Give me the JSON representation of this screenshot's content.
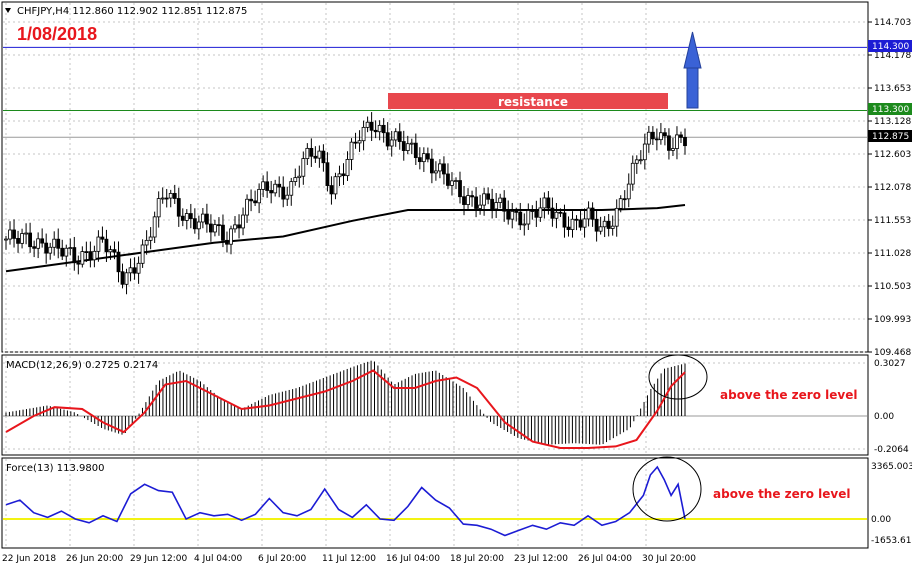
{
  "header": {
    "symbol_info": "CHFJPY,H4  112.860 112.902 112.851 112.875",
    "date_label": "1/08/2018"
  },
  "annotations": {
    "resistance": "resistance",
    "macd_note": "above the zero level",
    "force_note": "above the zero level"
  },
  "colors": {
    "grid": "#c4c4c4",
    "background": "#ffffff",
    "candles": "#000000",
    "fast_ma": "#ffffff",
    "slow_ma": "#000000",
    "macd_signal": "#e8161c",
    "force_line": "#1c1cd4",
    "zero_line": "#f3f312",
    "level_114300": "#1c1cd4",
    "level_113300": "#1c8a1c",
    "resistance_box": "#e8474d",
    "arrow": "#3a62d6"
  },
  "chart_data": [
    {
      "type": "candlestick",
      "panel": "price",
      "y_ticks": [
        "114.703",
        "114.178",
        "113.653",
        "113.128",
        "112.603",
        "112.078",
        "111.553",
        "111.028",
        "110.503",
        "109.993",
        "109.468"
      ],
      "ylim": [
        109.468,
        114.703
      ],
      "current_price_label": "112.875",
      "current_price": 112.875,
      "levels": [
        {
          "label": "114.300",
          "value": 114.3
        },
        {
          "label": "113.300",
          "value": 113.3
        }
      ],
      "x_ticks": [
        "22 Jun 2018",
        "26 Jun 20:00",
        "29 Jun 12:00",
        "4 Jul 04:00",
        "6 Jul 20:00",
        "11 Jul 12:00",
        "16 Jul 04:00",
        "18 Jul 20:00",
        "23 Jul 12:00",
        "26 Jul 04:00",
        "30 Jul 20:00"
      ],
      "close_path": [
        [
          0,
          111.26
        ],
        [
          6,
          111.2
        ],
        [
          10,
          110.92
        ],
        [
          14,
          111.25
        ],
        [
          17,
          110.58
        ],
        [
          20,
          111.15
        ],
        [
          23,
          112.0
        ],
        [
          26,
          111.62
        ],
        [
          29,
          111.46
        ],
        [
          32,
          111.3
        ],
        [
          34,
          111.65
        ],
        [
          36,
          111.9
        ],
        [
          38,
          112.12
        ],
        [
          41,
          112.02
        ],
        [
          43,
          112.48
        ],
        [
          45,
          112.68
        ],
        [
          47,
          112.08
        ],
        [
          49,
          112.4
        ],
        [
          51,
          112.9
        ],
        [
          53,
          113.15
        ],
        [
          55,
          112.85
        ],
        [
          57,
          112.75
        ],
        [
          60,
          112.62
        ],
        [
          63,
          112.25
        ],
        [
          66,
          111.95
        ],
        [
          69,
          111.85
        ],
        [
          72,
          111.72
        ],
        [
          75,
          111.6
        ],
        [
          78,
          111.75
        ],
        [
          80,
          111.62
        ],
        [
          82,
          111.5
        ],
        [
          84,
          111.58
        ],
        [
          86,
          111.4
        ],
        [
          88,
          111.68
        ],
        [
          90,
          112.18
        ],
        [
          92,
          112.68
        ],
        [
          93,
          112.88
        ],
        [
          94,
          113.0
        ],
        [
          96,
          112.75
        ],
        [
          98,
          112.8
        ]
      ],
      "series": [
        {
          "name": "",
          "style": "white moving average",
          "points": [
            [
              0,
              110.95
            ],
            [
              10,
              111.0
            ],
            [
              18,
              111.15
            ],
            [
              24,
              111.55
            ],
            [
              30,
              111.6
            ],
            [
              36,
              111.72
            ],
            [
              42,
              111.95
            ],
            [
              48,
              112.3
            ],
            [
              54,
              112.75
            ],
            [
              57,
              112.82
            ],
            [
              62,
              112.55
            ],
            [
              68,
              112.15
            ],
            [
              74,
              111.9
            ],
            [
              80,
              111.8
            ],
            [
              86,
              111.75
            ],
            [
              90,
              111.95
            ],
            [
              94,
              112.2
            ],
            [
              98,
              112.35
            ]
          ]
        },
        {
          "name": "",
          "style": "black moving average",
          "points": [
            [
              0,
              110.75
            ],
            [
              10,
              110.9
            ],
            [
              20,
              111.05
            ],
            [
              30,
              111.2
            ],
            [
              40,
              111.3
            ],
            [
              50,
              111.55
            ],
            [
              58,
              111.72
            ],
            [
              68,
              111.72
            ],
            [
              78,
              111.72
            ],
            [
              86,
              111.72
            ],
            [
              94,
              111.75
            ],
            [
              98,
              111.8
            ]
          ]
        }
      ]
    },
    {
      "type": "bar+line",
      "panel": "macd",
      "title": "MACD(12,26,9) 0.2725 0.2174",
      "y_ticks": [
        "0.3027",
        "0.00",
        "-0.2064"
      ],
      "ylim": [
        -0.25,
        0.34
      ],
      "histogram_path": [
        [
          0,
          0.02
        ],
        [
          6,
          0.06
        ],
        [
          10,
          0.02
        ],
        [
          14,
          -0.08
        ],
        [
          17,
          -0.12
        ],
        [
          19,
          0.0
        ],
        [
          22,
          0.2
        ],
        [
          25,
          0.26
        ],
        [
          28,
          0.2
        ],
        [
          31,
          0.1
        ],
        [
          34,
          0.04
        ],
        [
          38,
          0.12
        ],
        [
          42,
          0.16
        ],
        [
          46,
          0.22
        ],
        [
          50,
          0.28
        ],
        [
          53,
          0.32
        ],
        [
          56,
          0.18
        ],
        [
          59,
          0.24
        ],
        [
          62,
          0.26
        ],
        [
          66,
          0.16
        ],
        [
          70,
          -0.04
        ],
        [
          74,
          -0.14
        ],
        [
          78,
          -0.18
        ],
        [
          82,
          -0.17
        ],
        [
          86,
          -0.18
        ],
        [
          90,
          -0.08
        ],
        [
          93,
          0.15
        ],
        [
          95,
          0.27
        ],
        [
          98,
          0.3
        ]
      ],
      "signal_path": [
        [
          0,
          -0.1
        ],
        [
          4,
          0.0
        ],
        [
          7,
          0.05
        ],
        [
          11,
          0.04
        ],
        [
          14,
          -0.04
        ],
        [
          17,
          -0.1
        ],
        [
          20,
          0.02
        ],
        [
          23,
          0.18
        ],
        [
          26,
          0.2
        ],
        [
          30,
          0.12
        ],
        [
          34,
          0.04
        ],
        [
          38,
          0.06
        ],
        [
          42,
          0.1
        ],
        [
          46,
          0.14
        ],
        [
          50,
          0.2
        ],
        [
          53,
          0.26
        ],
        [
          56,
          0.16
        ],
        [
          59,
          0.16
        ],
        [
          62,
          0.2
        ],
        [
          65,
          0.22
        ],
        [
          68,
          0.16
        ],
        [
          72,
          -0.04
        ],
        [
          76,
          -0.16
        ],
        [
          80,
          -0.2
        ],
        [
          84,
          -0.2
        ],
        [
          88,
          -0.19
        ],
        [
          91,
          -0.15
        ],
        [
          94,
          0.03
        ],
        [
          96,
          0.17
        ],
        [
          98,
          0.25
        ]
      ]
    },
    {
      "type": "line",
      "panel": "force",
      "title": "Force(13) 113.9800",
      "y_ticks": [
        "3365.0030",
        "0.00",
        "-1653.6180"
      ],
      "ylim": [
        -1653.618,
        3365.003
      ],
      "series": [
        {
          "name": "",
          "points": [
            [
              0,
              900
            ],
            [
              2,
              1200
            ],
            [
              4,
              400
            ],
            [
              6,
              100
            ],
            [
              8,
              500
            ],
            [
              10,
              0
            ],
            [
              12,
              -300
            ],
            [
              14,
              200
            ],
            [
              16,
              -200
            ],
            [
              18,
              1600
            ],
            [
              20,
              2200
            ],
            [
              22,
              1800
            ],
            [
              24,
              1700
            ],
            [
              26,
              0
            ],
            [
              28,
              400
            ],
            [
              30,
              200
            ],
            [
              32,
              300
            ],
            [
              34,
              -100
            ],
            [
              36,
              300
            ],
            [
              38,
              1300
            ],
            [
              40,
              400
            ],
            [
              42,
              200
            ],
            [
              44,
              600
            ],
            [
              46,
              1900
            ],
            [
              48,
              600
            ],
            [
              50,
              100
            ],
            [
              52,
              900
            ],
            [
              54,
              0
            ],
            [
              56,
              -100
            ],
            [
              58,
              800
            ],
            [
              60,
              2000
            ],
            [
              62,
              1200
            ],
            [
              64,
              700
            ],
            [
              66,
              -400
            ],
            [
              68,
              -500
            ],
            [
              70,
              -800
            ],
            [
              72,
              -1300
            ],
            [
              74,
              -900
            ],
            [
              76,
              -500
            ],
            [
              78,
              -800
            ],
            [
              80,
              -300
            ],
            [
              82,
              -500
            ],
            [
              84,
              200
            ],
            [
              86,
              -500
            ],
            [
              88,
              -200
            ],
            [
              90,
              400
            ],
            [
              92,
              1500
            ],
            [
              93,
              2800
            ],
            [
              94,
              3300
            ],
            [
              95,
              2500
            ],
            [
              96,
              1500
            ],
            [
              97,
              2200
            ],
            [
              98,
              0
            ]
          ]
        }
      ]
    }
  ]
}
